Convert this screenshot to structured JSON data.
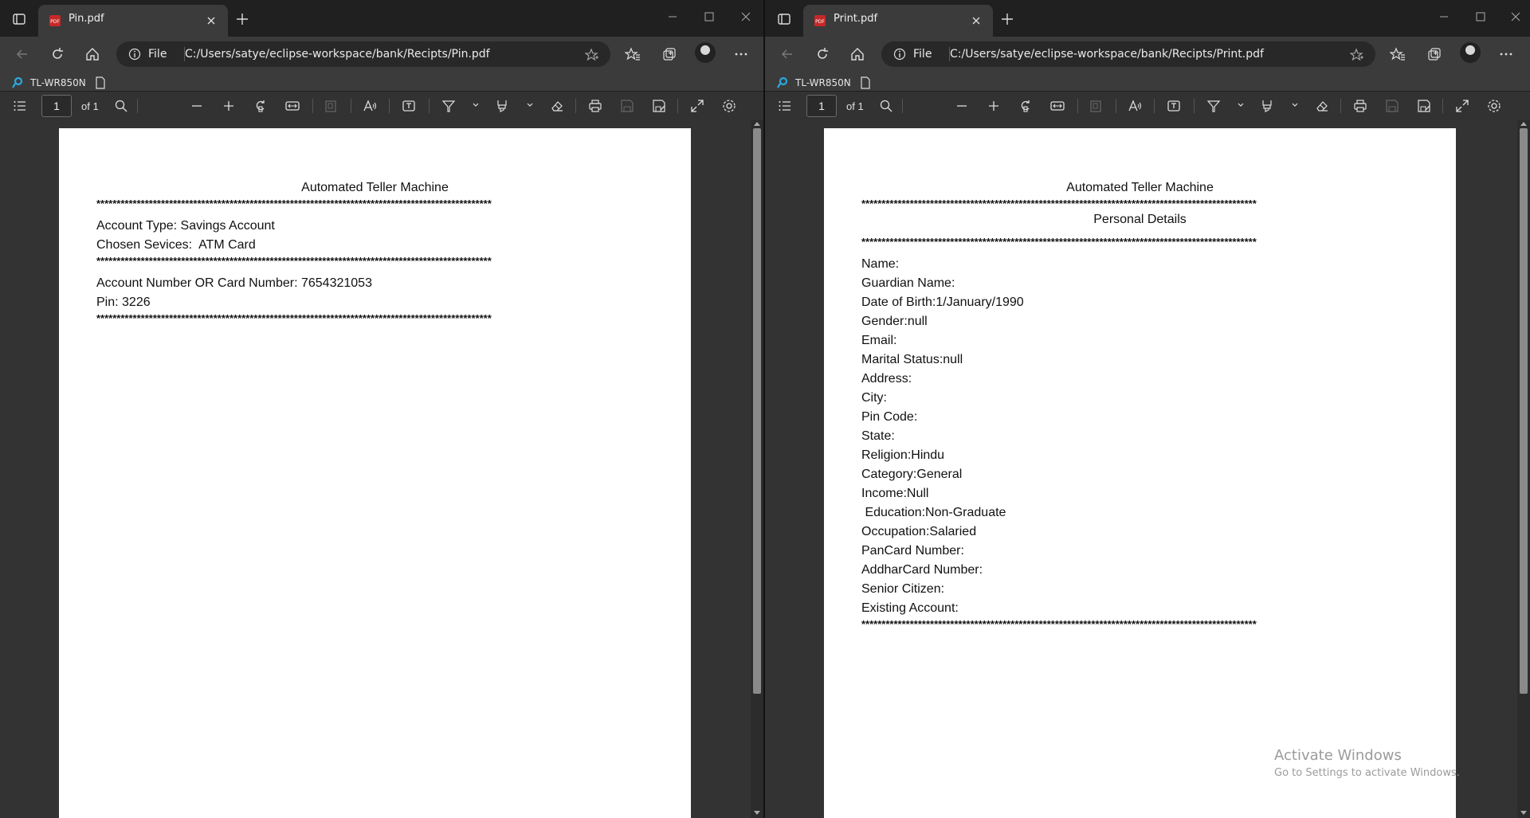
{
  "left_window": {
    "tab_title": "Pin.pdf",
    "address": {
      "scheme": "File",
      "url": "C:/Users/satye/eclipse-workspace/bank/Recipts/Pin.pdf"
    },
    "bookmark": "TL-WR850N",
    "pdf_toolbar": {
      "page_number": "1",
      "page_total": "of 1"
    },
    "document": {
      "title": "Automated Teller Machine",
      "separator": "**************************************************************************************************",
      "lines_a": [
        "Account Type: Savings Account",
        "Chosen Sevices:  ATM Card"
      ],
      "lines_b": [
        "Account Number OR Card Number: 7654321053",
        "Pin: 3226"
      ]
    }
  },
  "right_window": {
    "tab_title": "Print.pdf",
    "address": {
      "scheme": "File",
      "url": "C:/Users/satye/eclipse-workspace/bank/Recipts/Print.pdf"
    },
    "bookmark": "TL-WR850N",
    "pdf_toolbar": {
      "page_number": "1",
      "page_total": "of 1"
    },
    "document": {
      "title": "Automated Teller Machine",
      "subtitle": "Personal Details",
      "separator": "**************************************************************************************************",
      "fields": [
        "Name:",
        "Guardian Name:",
        "Date of Birth:1/January/1990",
        "Gender:null",
        "Email:",
        "Marital Status:null",
        "Address:",
        "City:",
        "Pin Code:",
        "State:",
        "Religion:Hindu",
        "Category:General",
        "Income:Null",
        " Education:Non-Graduate",
        "Occupation:Salaried",
        "PanCard Number:",
        "AddharCard Number:",
        "Senior Citizen:",
        "Existing Account:"
      ]
    }
  },
  "watermark": {
    "title": "Activate Windows",
    "subtitle": "Go to Settings to activate Windows."
  }
}
